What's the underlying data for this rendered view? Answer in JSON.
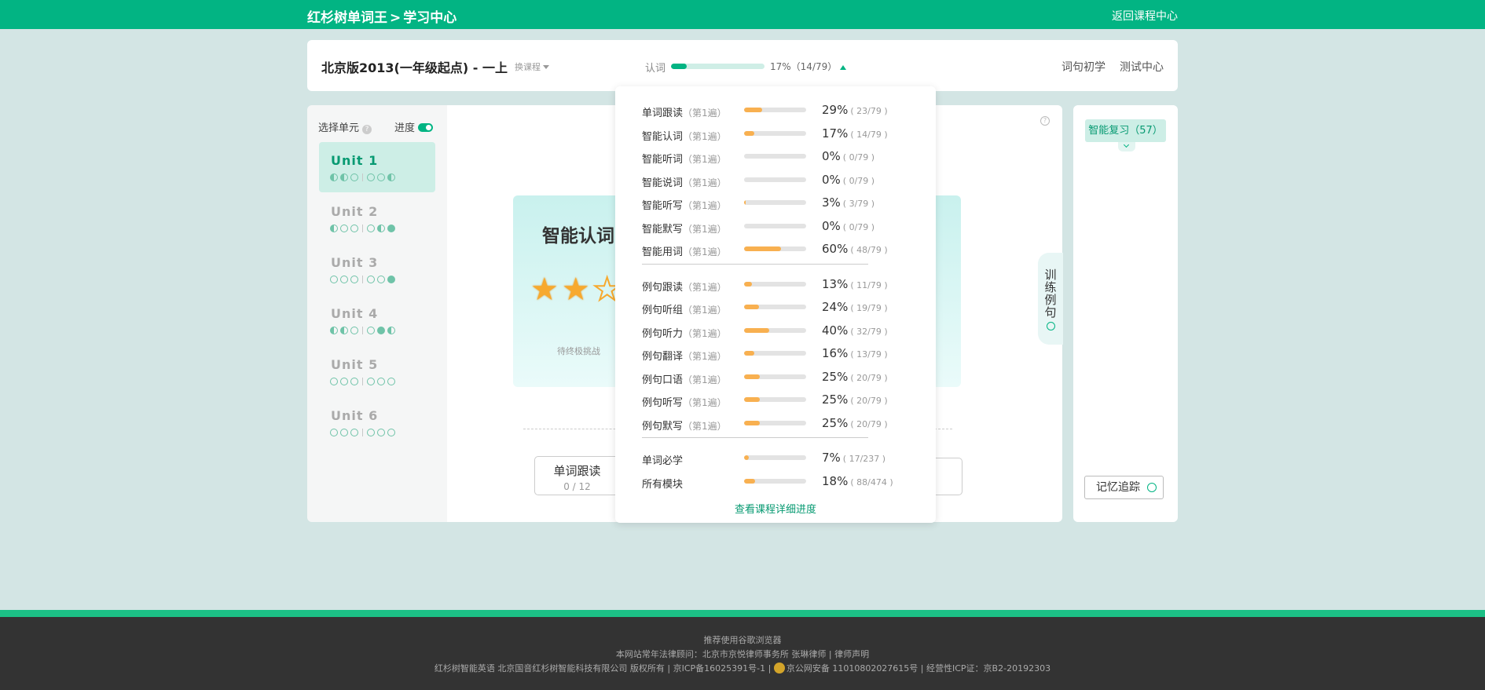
{
  "header": {
    "brand": "红杉树单词王",
    "separator": ">",
    "section": "学习中心",
    "back_link": "返回课程中心"
  },
  "course": {
    "title": "北京版2013(一年级起点) - 一上",
    "switch_label": "换课程",
    "overview_label": "认词",
    "overview_progress": 0.17,
    "overview_text": "17%（14/79）",
    "nav": [
      "词句初学",
      "测试中心"
    ]
  },
  "units_panel": {
    "select_label": "选择单元",
    "progress_label": "进度",
    "units": [
      {
        "name": "Unit 1",
        "dots": [
          "half",
          "half",
          "empty",
          "empty",
          "empty",
          "half"
        ]
      },
      {
        "name": "Unit 2",
        "dots": [
          "half",
          "empty",
          "empty",
          "empty",
          "half",
          "full"
        ]
      },
      {
        "name": "Unit 3",
        "dots": [
          "empty",
          "empty",
          "empty",
          "empty",
          "empty",
          "full"
        ]
      },
      {
        "name": "Unit 4",
        "dots": [
          "half",
          "half",
          "empty",
          "empty",
          "full",
          "half"
        ]
      },
      {
        "name": "Unit 5",
        "dots": [
          "empty",
          "empty",
          "empty",
          "empty",
          "empty",
          "empty"
        ]
      },
      {
        "name": "Unit 6",
        "dots": [
          "empty",
          "empty",
          "empty",
          "empty",
          "empty",
          "empty"
        ]
      }
    ]
  },
  "main": {
    "card_title": "智能认词",
    "stars_filled": 2,
    "stars_total": 3,
    "await_text": "待终极挑战",
    "module_title": "单词跟读",
    "module_count": "0 / 12",
    "side_tab": "训练例句"
  },
  "right": {
    "review_label": "智能复习（57）",
    "track_label": "记忆追踪"
  },
  "popup": {
    "groups": [
      [
        {
          "name": "单词跟读",
          "pass": "（第1遍）",
          "progress": 0.29,
          "pct": "29%",
          "count": "( 23/79 )"
        },
        {
          "name": "智能认词",
          "pass": "（第1遍）",
          "progress": 0.17,
          "pct": "17%",
          "count": "( 14/79 )"
        },
        {
          "name": "智能听词",
          "pass": "（第1遍）",
          "progress": 0,
          "pct": "0%",
          "count": "( 0/79 )"
        },
        {
          "name": "智能说词",
          "pass": "（第1遍）",
          "progress": 0,
          "pct": "0%",
          "count": "( 0/79 )"
        },
        {
          "name": "智能听写",
          "pass": "（第1遍）",
          "progress": 0.03,
          "pct": "3%",
          "count": "( 3/79 )"
        },
        {
          "name": "智能默写",
          "pass": "（第1遍）",
          "progress": 0,
          "pct": "0%",
          "count": "( 0/79 )"
        },
        {
          "name": "智能用词",
          "pass": "（第1遍）",
          "progress": 0.6,
          "pct": "60%",
          "count": "( 48/79 )"
        }
      ],
      [
        {
          "name": "例句跟读",
          "pass": "（第1遍）",
          "progress": 0.13,
          "pct": "13%",
          "count": "( 11/79 )"
        },
        {
          "name": "例句听组",
          "pass": "（第1遍）",
          "progress": 0.24,
          "pct": "24%",
          "count": "( 19/79 )"
        },
        {
          "name": "例句听力",
          "pass": "（第1遍）",
          "progress": 0.4,
          "pct": "40%",
          "count": "( 32/79 )"
        },
        {
          "name": "例句翻译",
          "pass": "（第1遍）",
          "progress": 0.16,
          "pct": "16%",
          "count": "( 13/79 )"
        },
        {
          "name": "例句口语",
          "pass": "（第1遍）",
          "progress": 0.25,
          "pct": "25%",
          "count": "( 20/79 )"
        },
        {
          "name": "例句听写",
          "pass": "（第1遍）",
          "progress": 0.25,
          "pct": "25%",
          "count": "( 20/79 )"
        },
        {
          "name": "例句默写",
          "pass": "（第1遍）",
          "progress": 0.25,
          "pct": "25%",
          "count": "( 20/79 )"
        }
      ],
      [
        {
          "name": "单词必学",
          "pass": "",
          "progress": 0.07,
          "pct": "7%",
          "count": "( 17/237 )"
        },
        {
          "name": "所有模块",
          "pass": "",
          "progress": 0.18,
          "pct": "18%",
          "count": "( 88/474 )"
        }
      ]
    ],
    "detail_link": "查看课程详细进度"
  },
  "footer": {
    "line1": "推荐使用谷歌浏览器",
    "line2": "本网站常年法律顾问：北京市京悦律师事务所 张琳律师 | 律师声明",
    "line3a": "红杉树智能英语 北京国音红杉树智能科技有限公司 版权所有 | 京ICP备16025391号-1 |",
    "line3b": "京公网安备 11010802027615号 | 经营性ICP证：京B2-20192303"
  },
  "colors": {
    "accent": "#02b483",
    "bar": "#f8b050",
    "bg": "#d3e5e4",
    "footer": "#333333"
  }
}
